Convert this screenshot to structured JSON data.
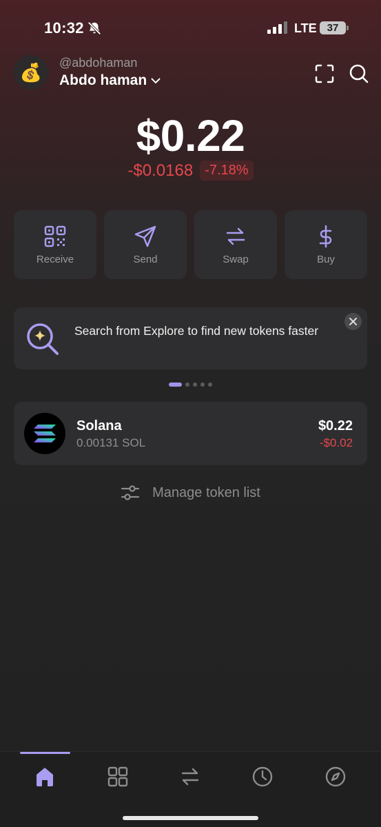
{
  "status_bar": {
    "time": "10:32",
    "network": "LTE",
    "battery": "37"
  },
  "header": {
    "avatar_emoji": "💰",
    "handle": "@abdohaman",
    "account_name": "Abdo haman"
  },
  "balance": {
    "amount": "$0.22",
    "change_abs": "-$0.0168",
    "change_pct": "-7.18%"
  },
  "actions": [
    {
      "label": "Receive",
      "icon": "qr-code-icon"
    },
    {
      "label": "Send",
      "icon": "send-icon"
    },
    {
      "label": "Swap",
      "icon": "swap-icon"
    },
    {
      "label": "Buy",
      "icon": "dollar-icon"
    }
  ],
  "banner": {
    "text": "Search from Explore to find new tokens faster",
    "icon": "explore-search-icon"
  },
  "carousel": {
    "page_count": 5,
    "active_index": 0
  },
  "tokens": [
    {
      "name": "Solana",
      "amount": "0.00131 SOL",
      "value": "$0.22",
      "change": "-$0.02",
      "icon": "solana-logo-icon"
    }
  ],
  "manage_label": "Manage token list",
  "nav": {
    "active": "home",
    "items": [
      "home-icon",
      "collectibles-grid-icon",
      "swap-icon",
      "history-clock-icon",
      "explore-compass-icon"
    ]
  },
  "colors": {
    "accent": "#a89df0",
    "negative": "#e5484d",
    "card": "#2e2e30"
  }
}
